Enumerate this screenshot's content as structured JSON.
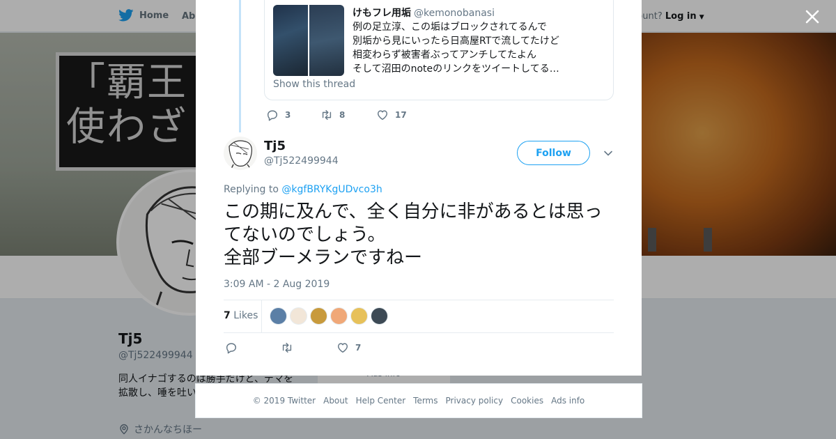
{
  "background_page": {
    "nav": {
      "home_label": "Home",
      "about_label": "Abo",
      "login_prefix": "ccount?",
      "login_label": "Log in"
    },
    "banner_text": "「覇王\n使わざ",
    "profile": {
      "name": "Tj5",
      "handle": "@Tj522499944",
      "bio": "同人イナゴするのは勝手だけど、デマを拡散し、唾を吐い... さない。 実生活が...",
      "location": "さかんなちほー",
      "ads_info_partial": "Ads info"
    }
  },
  "modal": {
    "quoted_tweet": {
      "name": "けもフレ用垢",
      "handle": "@kemonobanasi",
      "lines": [
        "例の足立淳、この垢はブロックされてるんで",
        "別垢から見にいったら日高屋RTで流してたけど",
        "相変わらず被害者ぶってアンチしてたよん",
        "そして沼田のnoteのリンクをツイートしてる…"
      ],
      "show_thread": "Show this thread"
    },
    "parent_actions": {
      "replies": "3",
      "retweets": "8",
      "likes": "17"
    },
    "author": {
      "name": "Tj5",
      "handle": "@Tj522499944",
      "follow_label": "Follow"
    },
    "replying_to": {
      "prefix": "Replying to",
      "handle": "@kgfBRYKgUDvco3h"
    },
    "tweet_text": "この期に及んで、全く自分に非があるとは思ってないのでしょう。\n全部ブーメランですねー",
    "timestamp": "3:09 AM - 2 Aug 2019",
    "stats": {
      "likes_count": "7",
      "likes_label": "Likes",
      "liker_colors": [
        "#5b7fa6",
        "#f2e6d8",
        "#c89a3c",
        "#f0a878",
        "#e7c15a",
        "#3d4a55"
      ]
    },
    "actions": {
      "replies": "",
      "retweets": "",
      "likes": "7"
    }
  },
  "footer": {
    "copyright": "© 2019 Twitter",
    "links": [
      "About",
      "Help Center",
      "Terms",
      "Privacy policy",
      "Cookies",
      "Ads info"
    ]
  },
  "colors": {
    "accent": "#1da1f2",
    "thread_line": "#c4e3f9",
    "muted": "#657786"
  }
}
